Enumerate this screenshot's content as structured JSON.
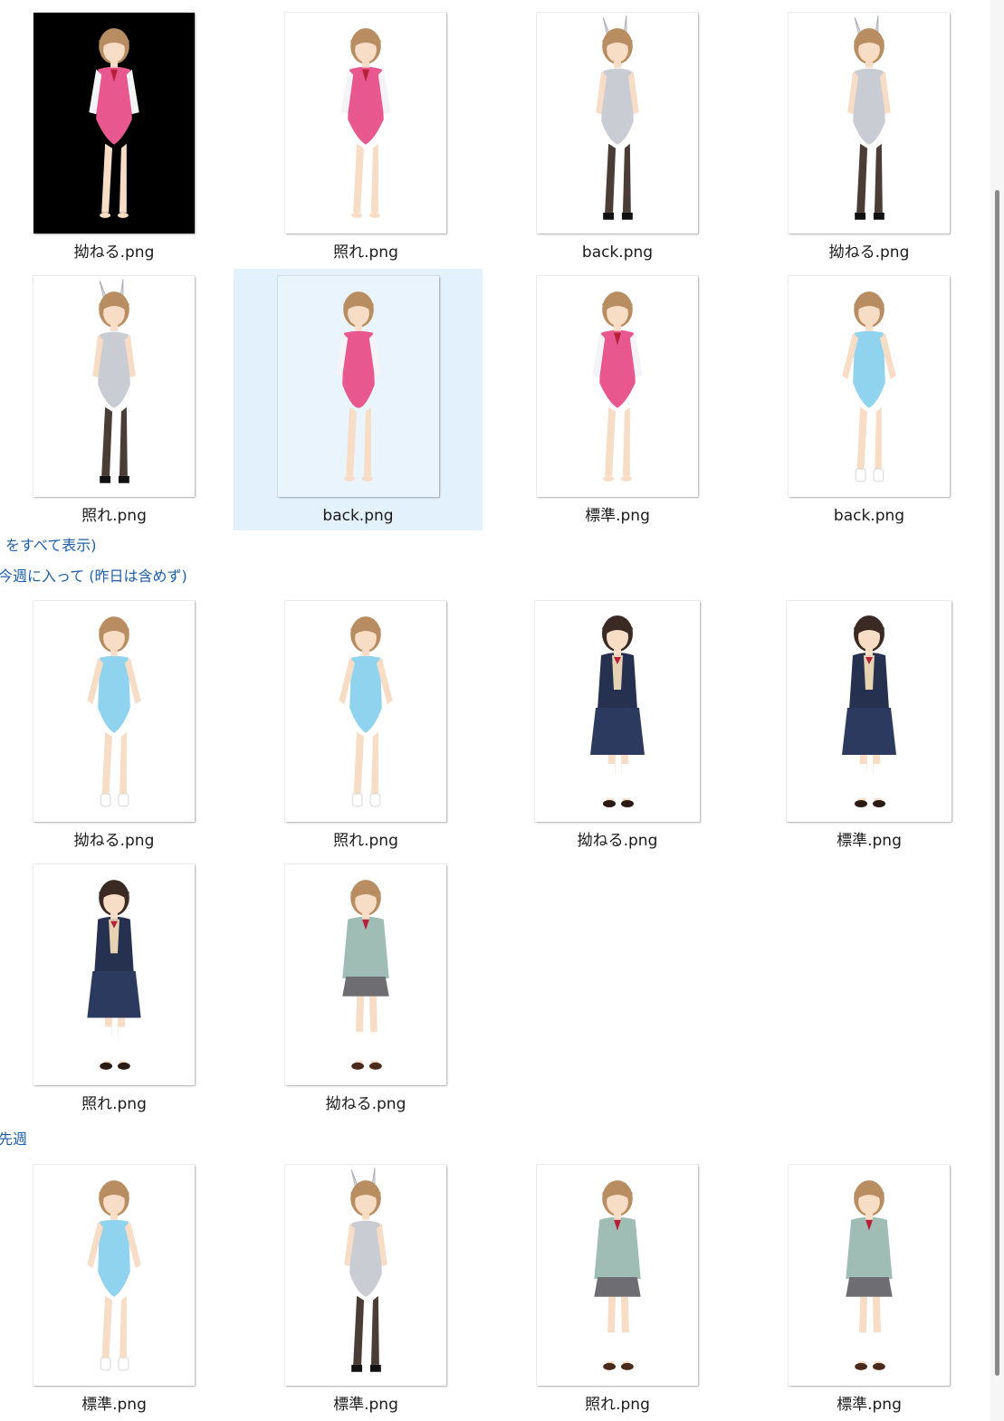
{
  "groups": {
    "show_all": "をすべて表示)",
    "this_week": "今週に入って (昨日は含めず)",
    "last_week": "先週"
  },
  "files": [
    {
      "name": "拗ねる.png",
      "figure": "pink-leotard",
      "background": "black"
    },
    {
      "name": "照れ.png",
      "figure": "pink-leotard",
      "background": "white"
    },
    {
      "name": "back.png",
      "figure": "bunny-back",
      "background": "white"
    },
    {
      "name": "拗ねる.png",
      "figure": "bunny-front",
      "background": "white"
    },
    {
      "name": "照れ.png",
      "figure": "bunny-front",
      "background": "white"
    },
    {
      "name": "back.png",
      "figure": "pink-back",
      "background": "white",
      "selected": true
    },
    {
      "name": "標準.png",
      "figure": "pink-leotard",
      "background": "white"
    },
    {
      "name": "back.png",
      "figure": "blue-swimsuit-back",
      "background": "white"
    },
    {
      "name": "拗ねる.png",
      "figure": "blue-swimsuit",
      "background": "white"
    },
    {
      "name": "照れ.png",
      "figure": "blue-swimsuit",
      "background": "white"
    },
    {
      "name": "拗ねる.png",
      "figure": "navy-uniform",
      "background": "white"
    },
    {
      "name": "標準.png",
      "figure": "navy-uniform",
      "background": "white"
    },
    {
      "name": "照れ.png",
      "figure": "navy-uniform",
      "background": "white"
    },
    {
      "name": "拗ねる.png",
      "figure": "green-cardigan",
      "background": "white"
    },
    {
      "name": "標準.png",
      "figure": "blue-swimsuit",
      "background": "white"
    },
    {
      "name": "標準.png",
      "figure": "bunny-front",
      "background": "white"
    },
    {
      "name": "照れ.png",
      "figure": "green-cardigan",
      "background": "white"
    },
    {
      "name": "標準.png",
      "figure": "green-cardigan",
      "background": "white"
    }
  ],
  "colors": {
    "selection": "#e3f1fd",
    "link": "#1f5fa8",
    "hair_light": "#b98d62",
    "hair_dark": "#3b2a24",
    "skin": "#f7dcc6",
    "pink": "#e8588e",
    "silver": "#c9ccd2",
    "aqua": "#8fd3ef",
    "navy": "#26304f",
    "sage": "#9fbdb4"
  }
}
